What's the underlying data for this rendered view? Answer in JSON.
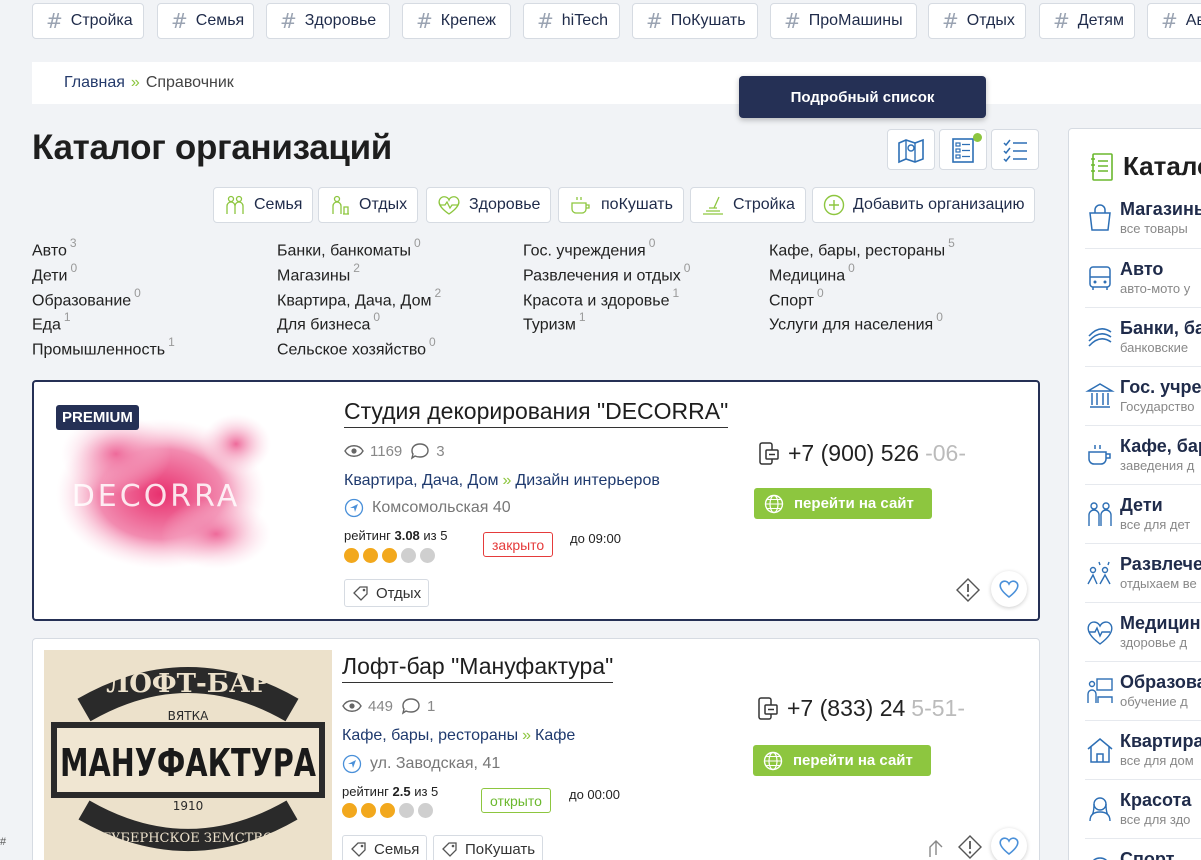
{
  "tags": [
    "Стройка",
    "Семья",
    "Здоровье",
    "Крепеж",
    "hiTech",
    "ПоКушать",
    "ПроМашины",
    "Отдых",
    "Детям",
    "Ав"
  ],
  "breadcrumb": {
    "home": "Главная",
    "current": "Справочник"
  },
  "tooltip": "Подробный список",
  "page_title": "Каталог организаций",
  "filters": [
    "Семья",
    "Отдых",
    "Здоровье",
    "поКушать",
    "Стройка",
    "Добавить организацию"
  ],
  "categories": [
    {
      "label": "Авто",
      "count": "3"
    },
    {
      "label": "Дети",
      "count": "0"
    },
    {
      "label": "Образование",
      "count": "0"
    },
    {
      "label": "Еда",
      "count": "1"
    },
    {
      "label": "Промышленность",
      "count": "1"
    },
    {
      "label": "Банки, банкоматы",
      "count": "0"
    },
    {
      "label": "Магазины",
      "count": "2"
    },
    {
      "label": "Квартира, Дача, Дом",
      "count": "2"
    },
    {
      "label": "Для бизнеса",
      "count": "0"
    },
    {
      "label": "Сельское хозяйство",
      "count": "0"
    },
    {
      "label": "Гос. учреждения",
      "count": "0"
    },
    {
      "label": "Развлечения и отдых",
      "count": "0"
    },
    {
      "label": "Красота и здоровье",
      "count": "1"
    },
    {
      "label": "Туризм",
      "count": "1"
    },
    {
      "label": "Кафе, бары, рестораны",
      "count": "5"
    },
    {
      "label": "Медицина",
      "count": "0"
    },
    {
      "label": "Спорт",
      "count": "0"
    },
    {
      "label": "Услуги для населения",
      "count": "0"
    }
  ],
  "cards": [
    {
      "badge": "PREMIUM",
      "photo_text": "DECORRA",
      "name": "Студия декорирования \"DECORRA\"",
      "views": "1169",
      "comments": "3",
      "rubric": "Квартира, Дача, Дом",
      "subrubric": "Дизайн интерьеров",
      "address": "Комсомольская 40",
      "rating_label": "рейтинг",
      "rating": "3.08",
      "rating_of": "из 5",
      "rating_value": 3.08,
      "status": "закрыто",
      "until": "до 09:00",
      "phone_main": "+7 (900) 526",
      "phone_fade": "-06-",
      "site": "перейти на сайт",
      "tags": [
        "Отдых"
      ]
    },
    {
      "photo_text": "МАНУФАКТУРА",
      "photo_top": "ЛОФТ-БАР",
      "photo_sub": "ВЯТКА",
      "photo_bottom": "ГУБЕРНСКОЕ ЗЕМСТВО",
      "photo_year": "1910",
      "name": "Лофт-бар \"Мануфактура\"",
      "views": "449",
      "comments": "1",
      "rubric": "Кафе, бары, рестораны",
      "subrubric": "Кафе",
      "address": "ул. Заводская, 41",
      "rating_label": "рейтинг",
      "rating": "2.5",
      "rating_of": "из 5",
      "rating_value": 2.5,
      "status": "открыто",
      "until": "до 00:00",
      "phone_main": "+7 (833) 24",
      "phone_fade": "5-51-",
      "site": "перейти на сайт",
      "tags": [
        "Семья",
        "ПоКушать"
      ]
    }
  ],
  "sidebar": {
    "title": "Каталог",
    "items": [
      {
        "title": "Магазины",
        "sub": "все товары"
      },
      {
        "title": "Авто",
        "sub": "авто-мото у"
      },
      {
        "title": "Банки, ба",
        "sub": "банковские"
      },
      {
        "title": "Гос. учре",
        "sub": "Государство"
      },
      {
        "title": "Кафе, бар",
        "sub": "заведения д"
      },
      {
        "title": "Дети",
        "sub": "все для дет"
      },
      {
        "title": "Развлече",
        "sub": "отдыхаем ве"
      },
      {
        "title": "Медицин",
        "sub": "здоровье д"
      },
      {
        "title": "Образова",
        "sub": "обучение д"
      },
      {
        "title": "Квартира",
        "sub": "все для дом"
      },
      {
        "title": "Красота",
        "sub": "все для здо"
      },
      {
        "title": "Спорт",
        "sub": ""
      }
    ]
  },
  "corner_mark": "#",
  "colors": {
    "navy": "#253055",
    "green": "#8dc63f",
    "orange": "#f2a81d",
    "red": "#e53b3b"
  }
}
